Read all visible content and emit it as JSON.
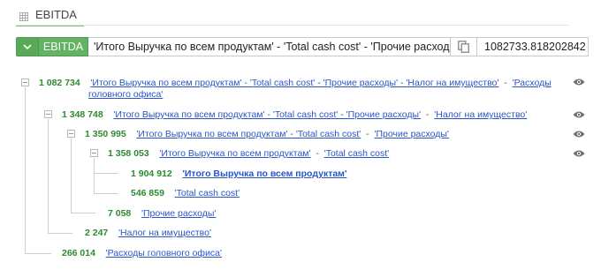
{
  "tab": {
    "label": "EBITDA",
    "icon": "table-icon"
  },
  "formula_bar": {
    "name": "EBITDA",
    "formula": "'Итого Выручка по всем продуктам' - 'Total cash cost' - 'Прочие расходы' - 'Налог на имущество' - 'Расходы головного офиса'",
    "value": "1082733.818202842",
    "accent_color": "#64b364"
  },
  "tree": {
    "n1": {
      "value": "1 082 734",
      "r1": "'Итого Выручка по всем продуктам' - 'Total cash cost' - 'Прочие расходы' - 'Налог на имущество'",
      "s1": "-",
      "r2": "'Расходы",
      "r2b": "головного офиса'"
    },
    "n2": {
      "value": "1 348 748",
      "r1": "'Итого Выручка по всем продуктам' - 'Total cash cost' - 'Прочие расходы'",
      "s1": "-",
      "r2": "'Налог на имущество'"
    },
    "n3": {
      "value": "1 350 995",
      "r1": "'Итого Выручка по всем продуктам' - 'Total cash cost'",
      "s1": "-",
      "r2": "'Прочие расходы'"
    },
    "n4": {
      "value": "1 358 053",
      "r1": "'Итого Выручка по всем продуктам'",
      "s1": "-",
      "r2": "'Total cash cost'"
    },
    "n5": {
      "value": "1 904 912",
      "r1": "'Итого Выручка по всем продуктам'"
    },
    "n6": {
      "value": "546 859",
      "r1": "'Total cash cost'"
    },
    "n7": {
      "value": "7 058",
      "r1": "'Прочие расходы'"
    },
    "n8": {
      "value": "2 247",
      "r1": "'Налог на имущество'"
    },
    "n9": {
      "value": "266 014",
      "r1": "'Расходы головного офиса'"
    }
  }
}
